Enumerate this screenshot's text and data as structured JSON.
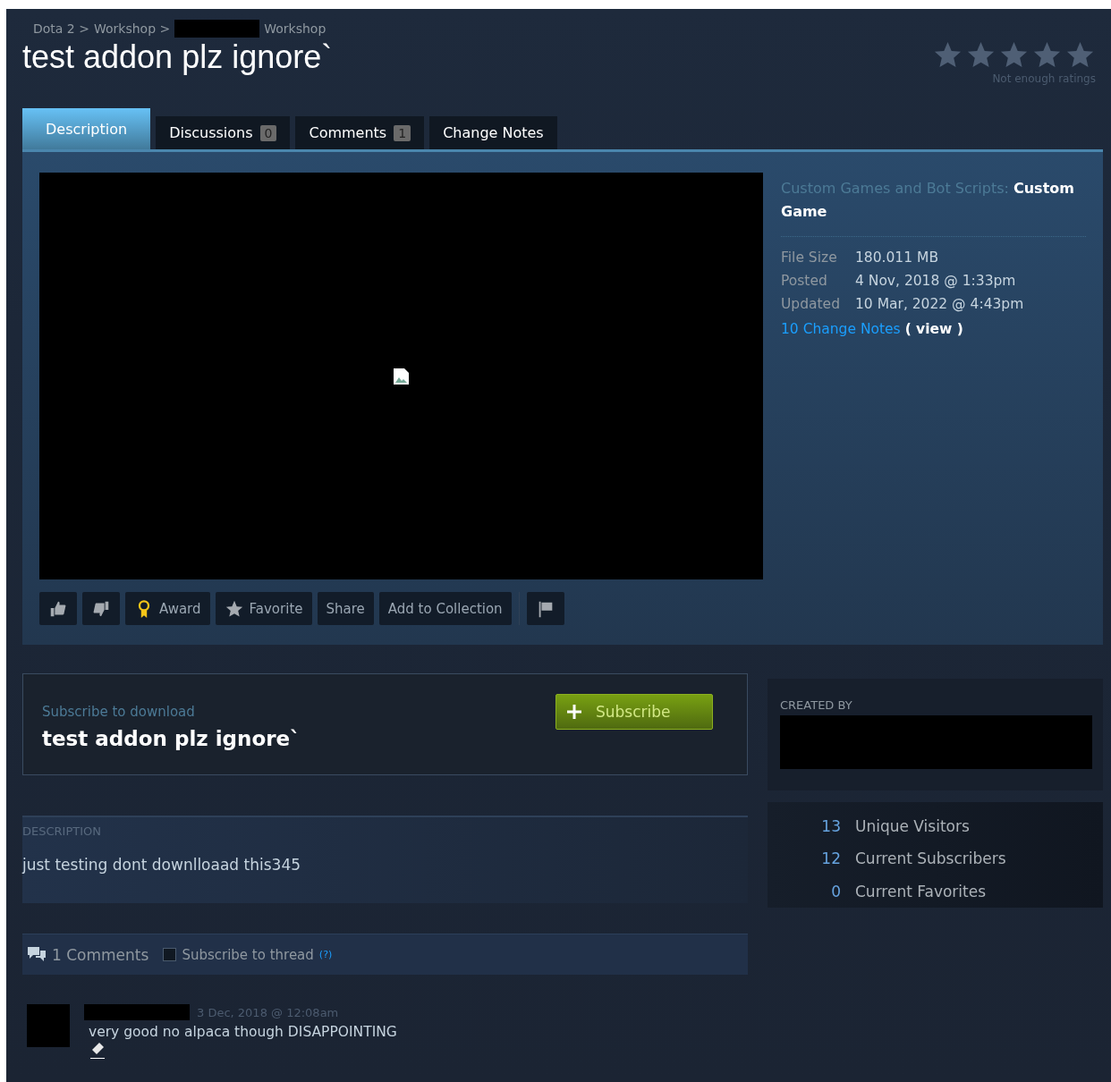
{
  "breadcrumb": [
    "Dota 2 >",
    "Workshop >",
    "Workshop"
  ],
  "title": "test addon plz ignore`",
  "rating": {
    "label": "Not enough ratings"
  },
  "tabs": [
    {
      "label": "Description",
      "selected": true
    },
    {
      "label": "Discussions",
      "count": "0",
      "selected": false
    },
    {
      "label": "Comments",
      "count": "1",
      "selected": false
    },
    {
      "label": "Change Notes",
      "selected": false
    }
  ],
  "actions": [
    {
      "kind": "thumbs-up"
    },
    {
      "kind": "thumbs-down"
    },
    {
      "kind": "award",
      "label": "Award"
    },
    {
      "kind": "favorite",
      "label": "Favorite"
    },
    {
      "kind": "text",
      "label": "Share"
    },
    {
      "kind": "text",
      "label": "Add to Collection"
    },
    {
      "kind": "flag"
    }
  ],
  "category": {
    "label": "Custom Games and Bot Scripts:",
    "value": "Custom Game"
  },
  "details": [
    {
      "label": "File Size",
      "value": "180.011 MB"
    },
    {
      "label": "Posted",
      "value": "4 Nov, 2018 @ 1:33pm"
    },
    {
      "label": "Updated",
      "value": "10 Mar, 2022 @ 4:43pm"
    }
  ],
  "change_notes": {
    "link": "10 Change Notes",
    "view": "( view )"
  },
  "subscribe_box": {
    "caption": "Subscribe to download",
    "title": "test addon plz ignore`",
    "button": "Subscribe"
  },
  "created_by": {
    "heading": "CREATED BY"
  },
  "stats": [
    {
      "value": "13",
      "label": "Unique Visitors"
    },
    {
      "value": "12",
      "label": "Current Subscribers"
    },
    {
      "value": "0",
      "label": "Current Favorites"
    }
  ],
  "description": {
    "heading": "DESCRIPTION",
    "text": "just testing dont downlloaad this345"
  },
  "comments": {
    "count_label": "1 Comments",
    "subscribe_label": "Subscribe to thread",
    "help": "(?)",
    "subscribed": false,
    "items": [
      {
        "date": "3 Dec, 2018 @ 12:08am",
        "text": "very good no alpaca though DISAPPOINTING"
      }
    ]
  }
}
